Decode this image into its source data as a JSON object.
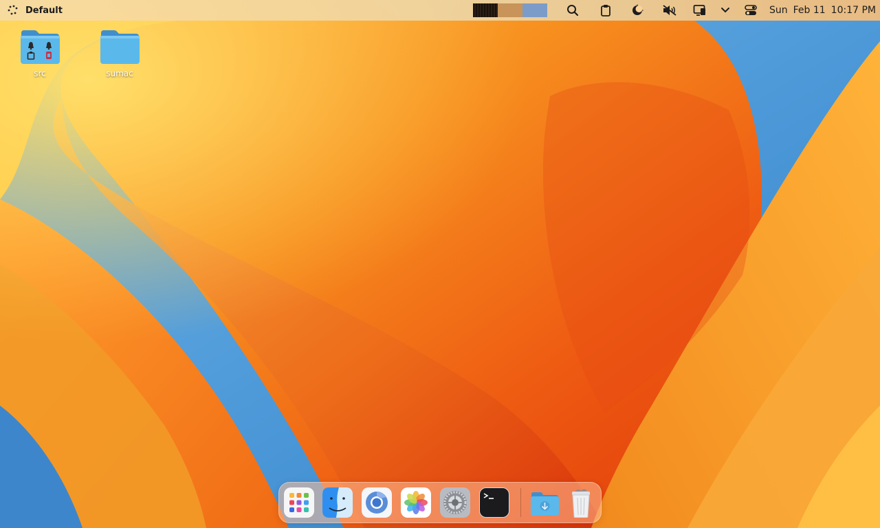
{
  "menubar": {
    "apps_icon": "apps-grid-icon",
    "profile_label": "Default",
    "workspace_colors": [
      "#231a12",
      "#c8945a",
      "#7b9cc9"
    ],
    "tray_icons": [
      "search-icon",
      "clipboard-icon",
      "night-light-icon",
      "volume-muted-icon",
      "screen-share-icon",
      "chevron-down-icon",
      "control-center-icon"
    ],
    "clock": {
      "day": "Sun",
      "date": "Feb 11",
      "time": "10:17 PM"
    }
  },
  "desktop": {
    "icons": [
      {
        "label": "src",
        "icon": "folder-with-emblems-icon"
      },
      {
        "label": "sumac",
        "icon": "folder-icon"
      }
    ]
  },
  "dock": {
    "items": [
      {
        "name": "launchpad",
        "icon": "launchpad-icon"
      },
      {
        "name": "finder",
        "icon": "finder-icon"
      },
      {
        "name": "chromium",
        "icon": "chromium-icon"
      },
      {
        "name": "photos",
        "icon": "photos-icon"
      },
      {
        "name": "system-settings",
        "icon": "settings-gear-icon"
      },
      {
        "name": "terminal",
        "icon": "terminal-icon"
      },
      {
        "name": "downloads",
        "icon": "downloads-folder-icon"
      },
      {
        "name": "trash",
        "icon": "trash-icon"
      }
    ]
  },
  "colors": {
    "wallpaper_orange": "#f07a1e",
    "wallpaper_deep": "#e03a0a",
    "wallpaper_blue": "#3a8fd6",
    "folder_blue": "#5bb8ea"
  }
}
